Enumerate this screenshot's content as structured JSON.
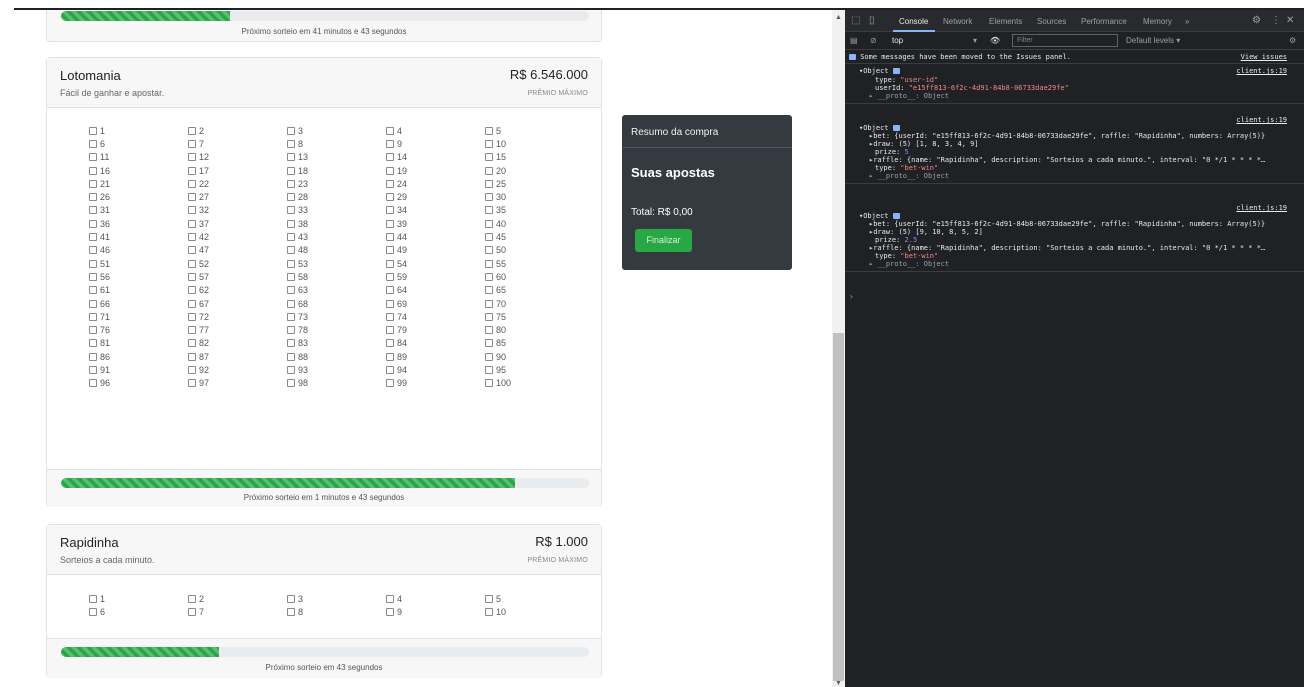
{
  "cards": {
    "top_countdown": "Próximo sorteio em 41 minutos e 43 segundos",
    "top_progress": 0.32,
    "lotomania": {
      "title": "Lotomania",
      "subtitle": "Fácil de ganhar e apostar.",
      "prize": "R$ 6.546.000",
      "prize_label": "PRÊMIO MÁXIMO",
      "numbers": [
        1,
        2,
        3,
        4,
        5,
        6,
        7,
        8,
        9,
        10,
        11,
        12,
        13,
        14,
        15,
        16,
        17,
        18,
        19,
        20,
        21,
        22,
        23,
        24,
        25,
        26,
        27,
        28,
        29,
        30,
        31,
        32,
        33,
        34,
        35,
        36,
        37,
        38,
        39,
        40,
        41,
        42,
        43,
        44,
        45,
        46,
        47,
        48,
        49,
        50,
        51,
        52,
        53,
        54,
        55,
        56,
        57,
        58,
        59,
        60,
        61,
        62,
        63,
        64,
        65,
        66,
        67,
        68,
        69,
        70,
        71,
        72,
        73,
        74,
        75,
        76,
        77,
        78,
        79,
        80,
        81,
        82,
        83,
        84,
        85,
        86,
        87,
        88,
        89,
        90,
        91,
        92,
        93,
        94,
        95,
        96,
        97,
        98,
        99,
        100
      ],
      "progress": 0.86,
      "countdown": "Próximo sorteio em 1 minutos e 43 segundos"
    },
    "rapidinha": {
      "title": "Rapidinha",
      "subtitle": "Sorteios a cada minuto.",
      "prize": "R$ 1.000",
      "prize_label": "PRÊMIO MÁXIMO",
      "numbers": [
        1,
        2,
        3,
        4,
        5,
        6,
        7,
        8,
        9,
        10
      ],
      "progress": 0.3,
      "countdown": "Próximo sorteio em 43 segundos"
    }
  },
  "summary": {
    "header": "Resumo da compra",
    "title": "Suas apostas",
    "total": "Total: R$ 0,00",
    "button": "Finalizar"
  },
  "devtools": {
    "tabs": [
      "Console",
      "Network",
      "Elements",
      "Sources",
      "Performance",
      "Memory",
      "»"
    ],
    "context": "top",
    "filter_placeholder": "Filter",
    "levels": "Default levels ▾",
    "issues_msg": "Some messages have been moved to the Issues panel.",
    "view_issues": "View issues",
    "log1": {
      "source": "client.js:19",
      "head": "▾Object",
      "type_key": "type: ",
      "type_val": "\"user-id\"",
      "uid_key": "userId: ",
      "uid_val": "\"e15ff813-6f2c-4d91-84b8-06733dae29fe\"",
      "proto": "▸ __proto__: Object"
    },
    "log2": {
      "source": "client.js:19",
      "head": "▾Object",
      "bet": "▸bet: {userId: \"e15ff813-6f2c-4d91-84b8-06733dae29fe\", raffle: \"Rapidinha\", numbers: Array(5)}",
      "draw": "▸draw: (5) [1, 8, 3, 4, 9]",
      "prize_key": "prize: ",
      "prize_val": "5",
      "raffle": "▸raffle: {name: \"Rapidinha\", description: \"Sorteios a cada minuto.\", interval: \"0 */1 * * * *…",
      "type_key": "type: ",
      "type_val": "\"bet-win\"",
      "proto": "▸ __proto__: Object"
    },
    "log3": {
      "source": "client.js:19",
      "head": "▾Object",
      "bet": "▸bet: {userId: \"e15ff813-6f2c-4d91-84b8-06733dae29fe\", raffle: \"Rapidinha\", numbers: Array(5)}",
      "draw": "▸draw: (5) [9, 10, 8, 5, 2]",
      "prize_key": "prize: ",
      "prize_val": "2.5",
      "raffle": "▸raffle: {name: \"Rapidinha\", description: \"Sorteios a cada minuto.\", interval: \"0 */1 * * * *…",
      "type_key": "type: ",
      "type_val": "\"bet-win\"",
      "proto": "▸ __proto__: Object"
    },
    "prompt": "›"
  },
  "icons": {
    "inspect": "inspect-icon",
    "device": "device-toggle-icon",
    "settings": "gear-icon",
    "more": "kebab-icon",
    "close": "close-icon"
  },
  "colors": {
    "success": "#28a745",
    "summary_bg": "#343a40",
    "devtools_bg": "#202124"
  }
}
